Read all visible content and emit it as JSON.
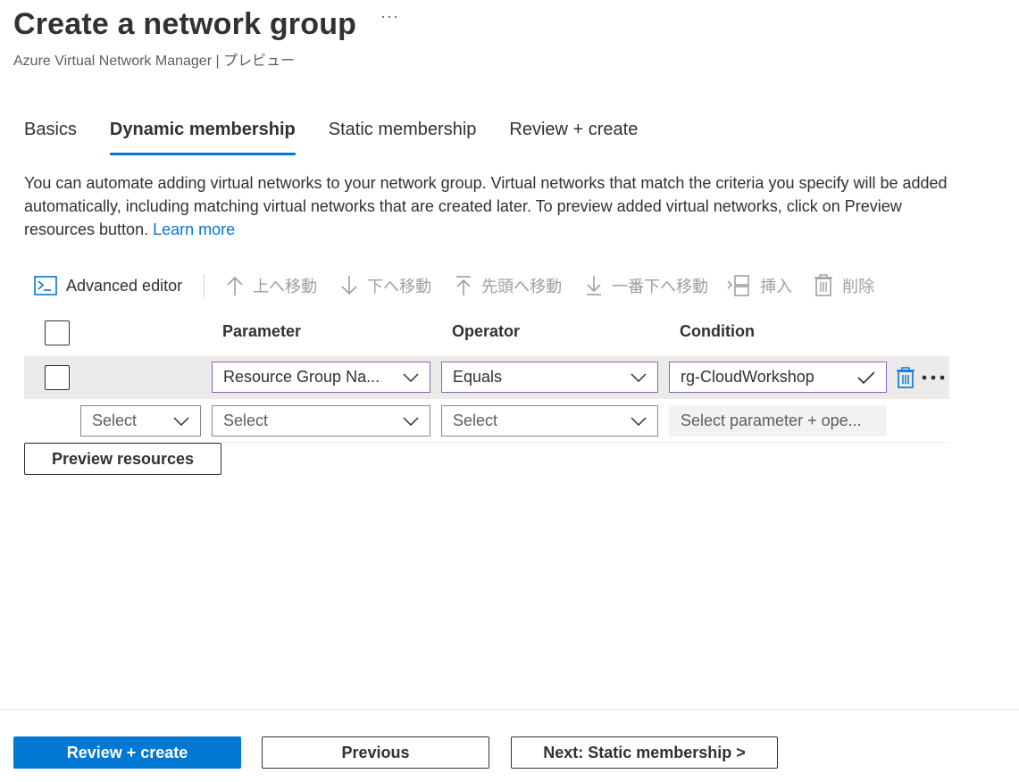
{
  "header": {
    "title": "Create a network group",
    "more_label": "···",
    "subtitle": "Azure Virtual Network Manager | プレビュー"
  },
  "tabs": [
    {
      "label": "Basics",
      "active": false
    },
    {
      "label": "Dynamic membership",
      "active": true
    },
    {
      "label": "Static membership",
      "active": false
    },
    {
      "label": "Review + create",
      "active": false
    }
  ],
  "description": {
    "text": "You can automate adding virtual networks to your network group. Virtual networks that match the criteria you specify will be added automatically, including matching virtual networks that are created later. To preview added virtual networks, click on Preview resources button. ",
    "link": "Learn more"
  },
  "toolbar": {
    "advanced_editor": "Advanced editor",
    "move_up": "上へ移動",
    "move_down": "下へ移動",
    "move_top": "先頭へ移動",
    "move_bottom": "一番下へ移動",
    "insert": "挿入",
    "delete": "削除"
  },
  "grid": {
    "headers": {
      "parameter": "Parameter",
      "operator": "Operator",
      "condition": "Condition"
    },
    "row1": {
      "parameter": "Resource Group Na...",
      "operator": "Equals",
      "condition": "rg-CloudWorkshop"
    },
    "row2": {
      "andor": "Select",
      "parameter": "Select",
      "operator": "Select",
      "condition": "Select parameter + ope..."
    }
  },
  "preview_button": "Preview resources",
  "footer": {
    "review_create": "Review + create",
    "previous": "Previous",
    "next": "Next: Static membership >"
  },
  "colors": {
    "accent": "#0078d4",
    "focus_border": "#8764b8",
    "row_highlight": "#edebe9"
  }
}
